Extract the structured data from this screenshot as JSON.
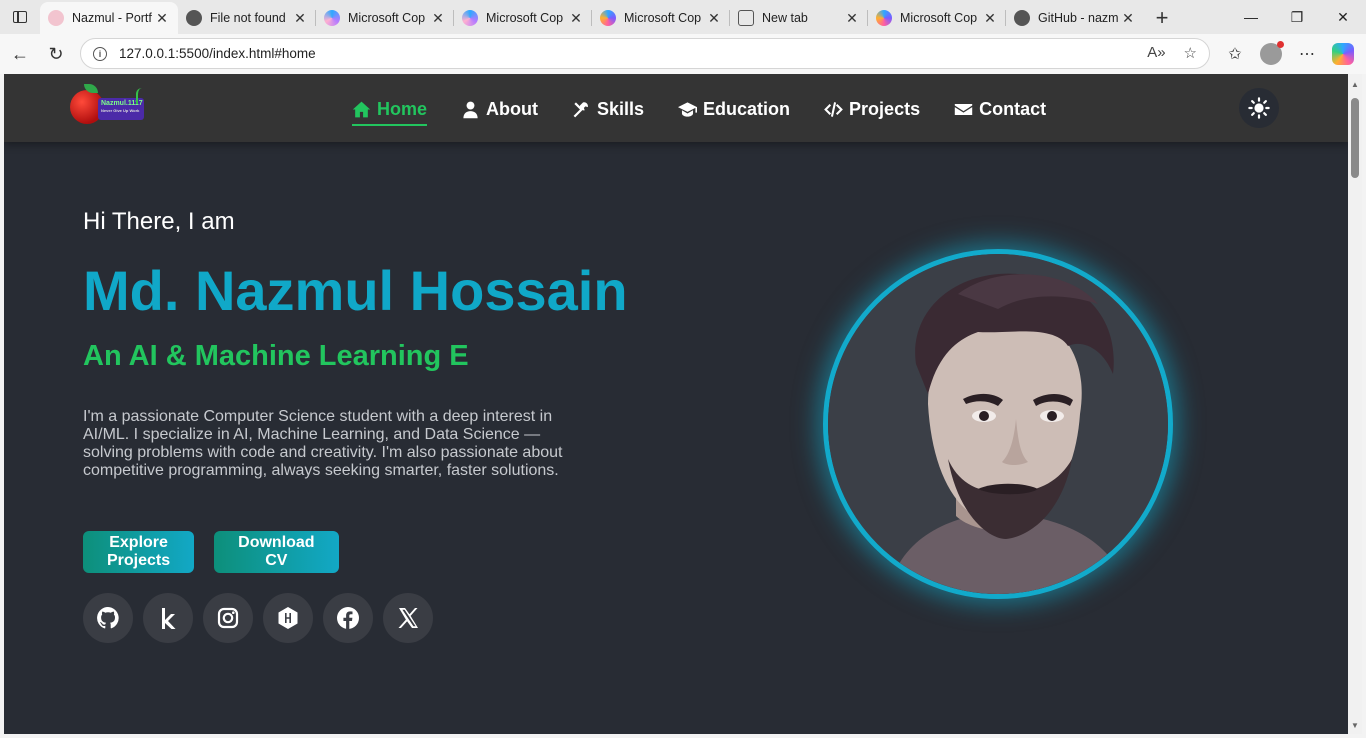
{
  "browser": {
    "tabs": [
      {
        "title": "Nazmul - Portf",
        "active": true
      },
      {
        "title": "File not found",
        "active": false
      },
      {
        "title": "Microsoft Cop",
        "active": false
      },
      {
        "title": "Microsoft Cop",
        "active": false
      },
      {
        "title": "Microsoft Cop",
        "active": false
      },
      {
        "title": "New tab",
        "active": false
      },
      {
        "title": "Microsoft Cop",
        "active": false
      },
      {
        "title": "GitHub - nazm",
        "active": false
      }
    ],
    "url": "127.0.0.1:5500/index.html#home"
  },
  "logo": {
    "text": "Nazmul.1117",
    "subtext": "Never Give Up Work"
  },
  "nav": {
    "items": [
      {
        "label": "Home",
        "icon": "home-icon"
      },
      {
        "label": "About",
        "icon": "user-icon"
      },
      {
        "label": "Skills",
        "icon": "tools-icon"
      },
      {
        "label": "Education",
        "icon": "graduation-cap-icon"
      },
      {
        "label": "Projects",
        "icon": "code-icon"
      },
      {
        "label": "Contact",
        "icon": "envelope-icon"
      }
    ],
    "active": "Home"
  },
  "hero": {
    "greeting": "Hi There, I am",
    "name": "Md. Nazmul Hossain",
    "role": "An AI & Machine Learning E",
    "bio": "I'm a passionate Computer Science student with a deep interest in AI/ML. I specialize in AI, Machine Learning, and Data Science — solving problems with code and creativity. I'm also passionate about competitive programming, always seeking smarter, faster solutions.",
    "buttons": {
      "explore": "Explore Projects",
      "download": "Download CV"
    },
    "socials": [
      "github-icon",
      "kaggle-icon",
      "instagram-icon",
      "hackerrank-icon",
      "facebook-icon",
      "x-icon"
    ]
  },
  "colors": {
    "accent_cyan": "#10a8c8",
    "accent_green": "#22c55e",
    "page_bg": "#282c34",
    "navbar_bg": "#343434"
  }
}
